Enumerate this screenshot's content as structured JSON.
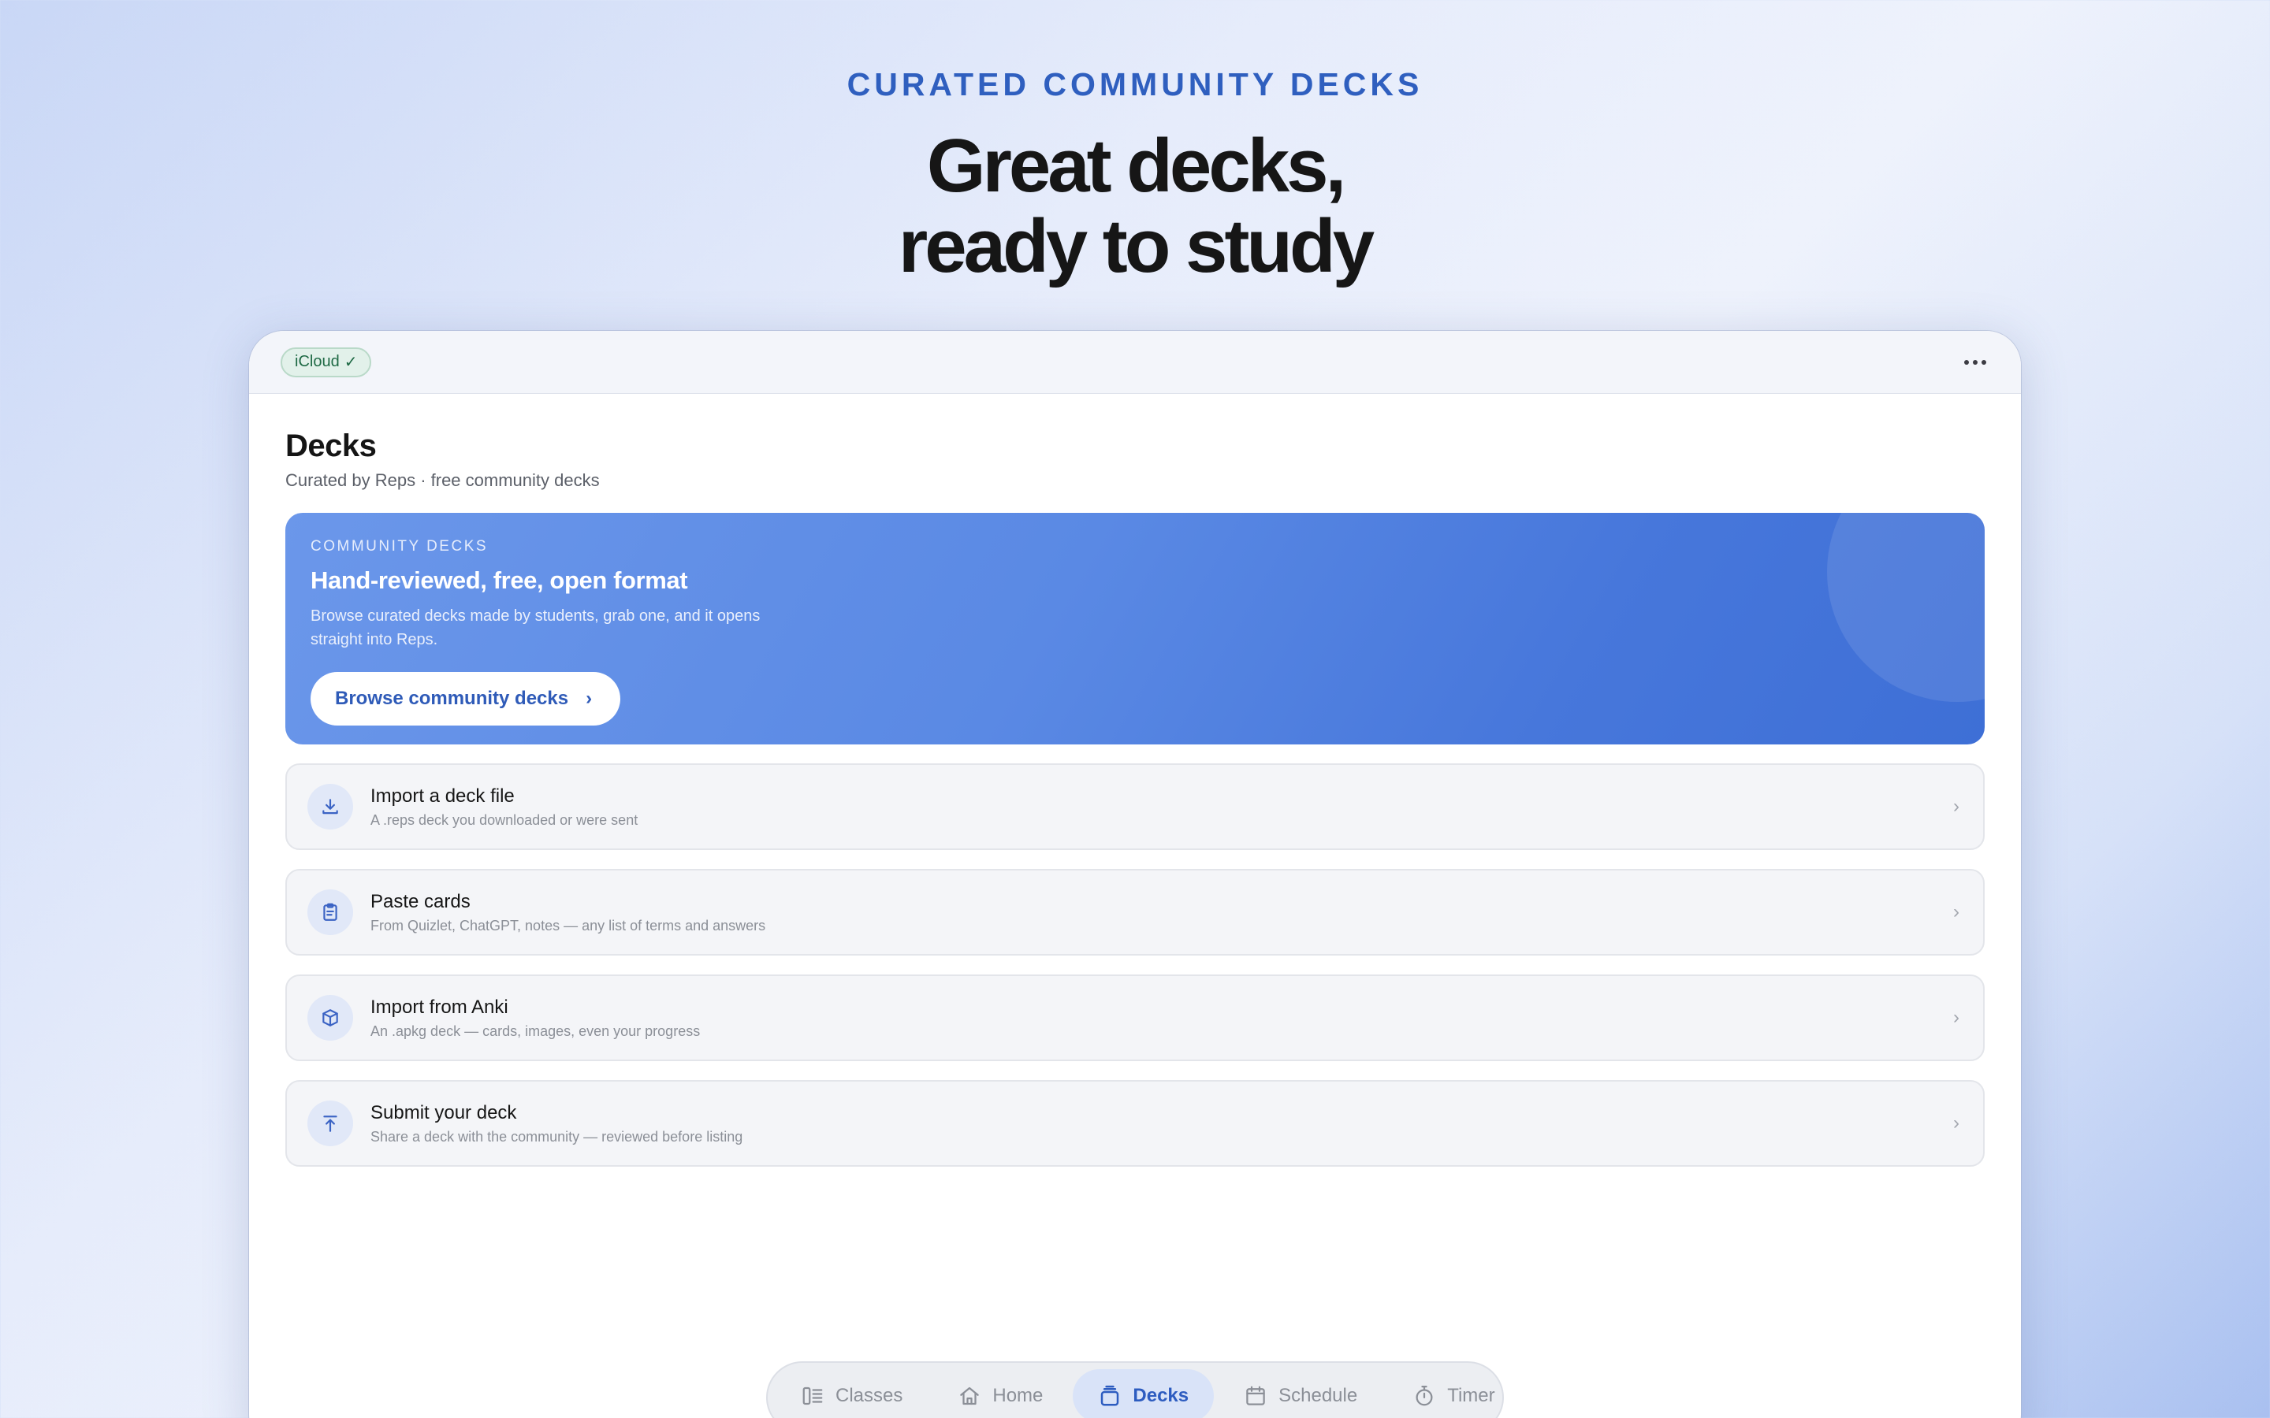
{
  "hero": {
    "eyebrow": "CURATED COMMUNITY DECKS",
    "title_line1": "Great decks,",
    "title_line2": "ready to study"
  },
  "topbar": {
    "icloud_label": "iCloud",
    "icloud_check": "✓",
    "more_icon": "ellipsis-icon"
  },
  "page": {
    "title": "Decks",
    "subtitle": "Curated by Reps · free community decks"
  },
  "banner": {
    "eyebrow": "COMMUNITY DECKS",
    "title": "Hand-reviewed, free, open format",
    "description": "Browse curated decks made by students, grab one, and it opens straight into Reps.",
    "button_label": "Browse community decks",
    "button_chevron": "›"
  },
  "actions": [
    {
      "title": "Import a deck file",
      "subtitle": "A .reps deck you downloaded or were sent",
      "icon": "download-icon",
      "chevron": "›"
    },
    {
      "title": "Paste cards",
      "subtitle": "From Quizlet, ChatGPT, notes — any list of terms and answers",
      "icon": "clipboard-icon",
      "chevron": "›"
    },
    {
      "title": "Import from Anki",
      "subtitle": "An .apkg deck — cards, images, even your progress",
      "icon": "package-icon",
      "chevron": "›"
    },
    {
      "title": "Submit your deck",
      "subtitle": "Share a deck with the community — reviewed before listing",
      "icon": "upload-icon",
      "chevron": "›"
    }
  ],
  "tabbar": {
    "active": "Decks",
    "tabs": [
      {
        "label": "Classes",
        "icon": "columns-icon"
      },
      {
        "label": "Home",
        "icon": "house-icon"
      },
      {
        "label": "Decks",
        "icon": "stack-icon"
      },
      {
        "label": "Schedule",
        "icon": "calendar-icon"
      },
      {
        "label": "Timer",
        "icon": "stopwatch-icon"
      }
    ]
  },
  "colors": {
    "accent": "#2f5fbf",
    "banner_start": "#6b97ea",
    "banner_end": "#3e6fd6",
    "icloud_bg": "#e2f1ea",
    "icloud_text": "#1f6a45"
  }
}
